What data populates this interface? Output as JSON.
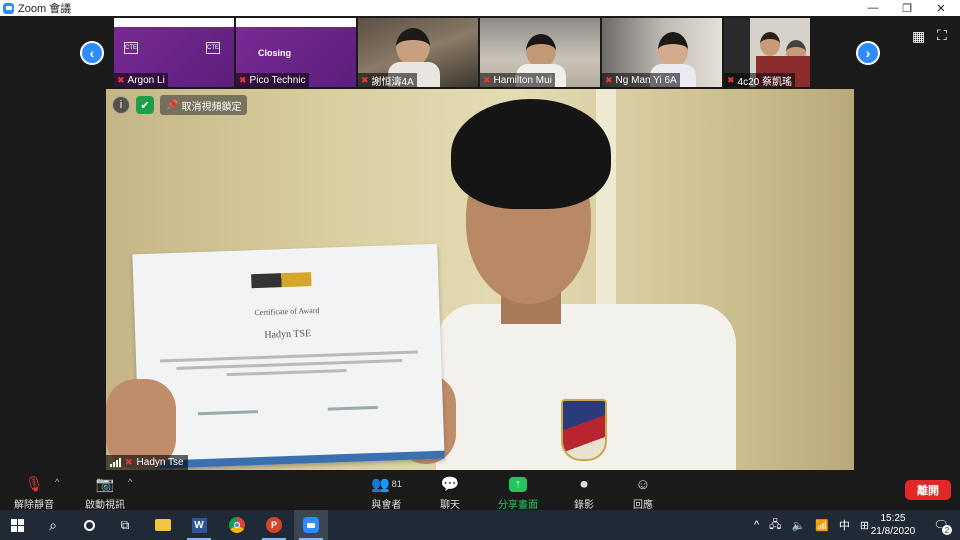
{
  "window": {
    "title": "Zoom 會議",
    "controls": {
      "minimize": "—",
      "restore": "❐",
      "close": "✕"
    }
  },
  "gallery": {
    "prev_icon": "chevron-left-icon",
    "next_icon": "chevron-right-icon",
    "participants": [
      {
        "name": "Argon Li",
        "type": "slide",
        "slide_text": "",
        "muted": true
      },
      {
        "name": "Pico Technic",
        "type": "slide",
        "slide_text": "Closing",
        "muted": true
      },
      {
        "name": "謝恒濤4A",
        "type": "camera",
        "muted": true
      },
      {
        "name": "Hamilton Mui",
        "type": "camera",
        "muted": true
      },
      {
        "name": "Ng Man Yi 6A",
        "type": "camera",
        "muted": true
      },
      {
        "name": "4c20 蔡凱瑤",
        "type": "camera",
        "muted": true
      }
    ],
    "view_icons": {
      "grid": "grid-view-icon",
      "fullscreen": "fullscreen-icon"
    }
  },
  "main_video": {
    "speaker": "Hadyn Tse",
    "pin_label": "取消視頻鎖定",
    "info_icon": "i",
    "security_icon": "shield-icon",
    "certificate": {
      "title": "Certificate of Award",
      "recipient": "Hadyn TSE"
    }
  },
  "toolbar": {
    "unmute": "解除靜音",
    "start_video": "啟動視訊",
    "participants": "與會者",
    "participants_count": "81",
    "chat": "聊天",
    "share_screen": "分享畫面",
    "record": "錄影",
    "reactions": "回應",
    "end": "離開"
  },
  "taskbar": {
    "time": "15:25",
    "date": "21/8/2020",
    "ime": "中",
    "notifications": "2"
  },
  "colors": {
    "accent_blue": "#2d8cff",
    "share_green": "#22c55e",
    "end_red": "#e02828",
    "muted_red": "#e53935",
    "taskbar": "#1f2a36"
  }
}
